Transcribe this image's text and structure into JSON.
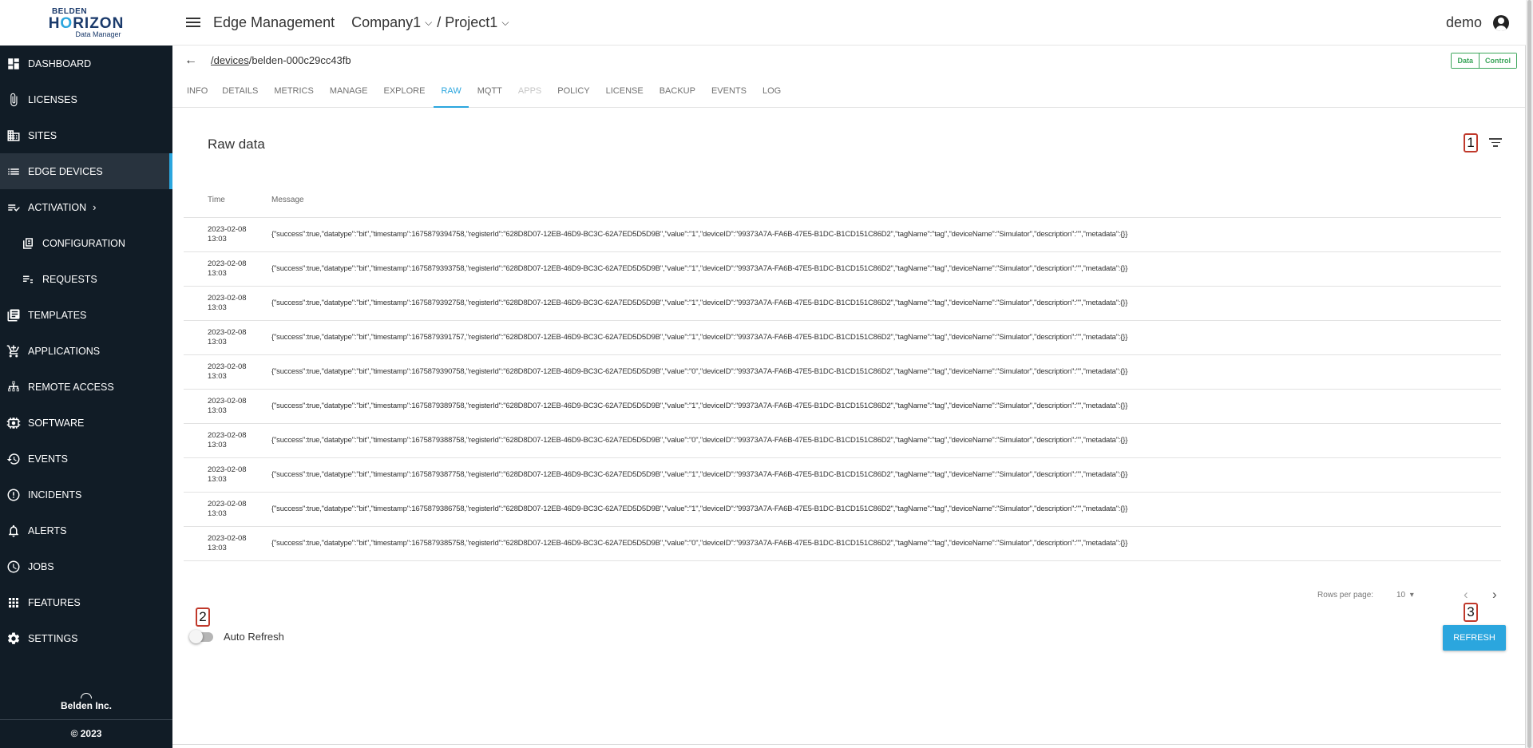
{
  "logo": {
    "brand": "BELDEN",
    "product_pre": "H",
    "product_o": "O",
    "product_post": "RIZON",
    "subtitle": "Data Manager"
  },
  "sidebar": {
    "items": [
      {
        "label": "DASHBOARD",
        "icon": "dashboard-icon"
      },
      {
        "label": "LICENSES",
        "icon": "paperclip-icon"
      },
      {
        "label": "SITES",
        "icon": "building-icon"
      },
      {
        "label": "EDGE DEVICES",
        "icon": "list-icon",
        "active": true
      },
      {
        "label": "ACTIVATION",
        "icon": "checklist-icon",
        "chevron": "›"
      },
      {
        "label": "CONFIGURATION",
        "icon": "config-icon"
      },
      {
        "label": "REQUESTS",
        "icon": "requests-icon"
      },
      {
        "label": "TEMPLATES",
        "icon": "templates-icon"
      },
      {
        "label": "APPLICATIONS",
        "icon": "cart-icon"
      },
      {
        "label": "REMOTE ACCESS",
        "icon": "network-icon"
      },
      {
        "label": "SOFTWARE",
        "icon": "software-icon"
      },
      {
        "label": "EVENTS",
        "icon": "history-icon"
      },
      {
        "label": "INCIDENTS",
        "icon": "alert-circle-icon"
      },
      {
        "label": "ALERTS",
        "icon": "bell-icon"
      },
      {
        "label": "JOBS",
        "icon": "clock-icon"
      },
      {
        "label": "FEATURES",
        "icon": "grid-icon"
      },
      {
        "label": "SETTINGS",
        "icon": "gear-icon"
      }
    ],
    "footer": {
      "company": "Belden Inc.",
      "copyright": "© 2023"
    }
  },
  "header": {
    "title": "Edge Management",
    "company": "Company1",
    "separator": "/",
    "project": "Project1",
    "user": "demo"
  },
  "device": {
    "path_link": "/devices",
    "path_rest": "/belden-000c29cc43fb",
    "toggle": [
      "Data",
      "Control"
    ]
  },
  "tabs": [
    {
      "label": "INFO"
    },
    {
      "label": "DETAILS"
    },
    {
      "label": "METRICS"
    },
    {
      "label": "MANAGE"
    },
    {
      "label": "EXPLORE"
    },
    {
      "label": "RAW",
      "active": true
    },
    {
      "label": "MQTT"
    },
    {
      "label": "APPS",
      "disabled": true
    },
    {
      "label": "POLICY"
    },
    {
      "label": "LICENSE"
    },
    {
      "label": "BACKUP"
    },
    {
      "label": "EVENTS"
    },
    {
      "label": "LOG"
    }
  ],
  "panel": {
    "title": "Raw data"
  },
  "markers": {
    "m1": "1",
    "m2": "2",
    "m3": "3"
  },
  "table": {
    "columns": [
      "Time",
      "Message"
    ],
    "rows": [
      {
        "date": "2023-02-08",
        "time": "13:03",
        "message": "{\"success\":true,\"datatype\":\"bit\",\"timestamp\":1675879394758,\"registerId\":\"628D8D07-12EB-46D9-BC3C-62A7ED5D5D9B\",\"value\":\"1\",\"deviceID\":\"99373A7A-FA6B-47E5-B1DC-B1CD151C86D2\",\"tagName\":\"tag\",\"deviceName\":\"Simulator\",\"description\":\"\",\"metadata\":{}}"
      },
      {
        "date": "2023-02-08",
        "time": "13:03",
        "message": "{\"success\":true,\"datatype\":\"bit\",\"timestamp\":1675879393758,\"registerId\":\"628D8D07-12EB-46D9-BC3C-62A7ED5D5D9B\",\"value\":\"1\",\"deviceID\":\"99373A7A-FA6B-47E5-B1DC-B1CD151C86D2\",\"tagName\":\"tag\",\"deviceName\":\"Simulator\",\"description\":\"\",\"metadata\":{}}"
      },
      {
        "date": "2023-02-08",
        "time": "13:03",
        "message": "{\"success\":true,\"datatype\":\"bit\",\"timestamp\":1675879392758,\"registerId\":\"628D8D07-12EB-46D9-BC3C-62A7ED5D5D9B\",\"value\":\"1\",\"deviceID\":\"99373A7A-FA6B-47E5-B1DC-B1CD151C86D2\",\"tagName\":\"tag\",\"deviceName\":\"Simulator\",\"description\":\"\",\"metadata\":{}}"
      },
      {
        "date": "2023-02-08",
        "time": "13:03",
        "message": "{\"success\":true,\"datatype\":\"bit\",\"timestamp\":1675879391757,\"registerId\":\"628D8D07-12EB-46D9-BC3C-62A7ED5D5D9B\",\"value\":\"1\",\"deviceID\":\"99373A7A-FA6B-47E5-B1DC-B1CD151C86D2\",\"tagName\":\"tag\",\"deviceName\":\"Simulator\",\"description\":\"\",\"metadata\":{}}"
      },
      {
        "date": "2023-02-08",
        "time": "13:03",
        "message": "{\"success\":true,\"datatype\":\"bit\",\"timestamp\":1675879390758,\"registerId\":\"628D8D07-12EB-46D9-BC3C-62A7ED5D5D9B\",\"value\":\"0\",\"deviceID\":\"99373A7A-FA6B-47E5-B1DC-B1CD151C86D2\",\"tagName\":\"tag\",\"deviceName\":\"Simulator\",\"description\":\"\",\"metadata\":{}}"
      },
      {
        "date": "2023-02-08",
        "time": "13:03",
        "message": "{\"success\":true,\"datatype\":\"bit\",\"timestamp\":1675879389758,\"registerId\":\"628D8D07-12EB-46D9-BC3C-62A7ED5D5D9B\",\"value\":\"1\",\"deviceID\":\"99373A7A-FA6B-47E5-B1DC-B1CD151C86D2\",\"tagName\":\"tag\",\"deviceName\":\"Simulator\",\"description\":\"\",\"metadata\":{}}"
      },
      {
        "date": "2023-02-08",
        "time": "13:03",
        "message": "{\"success\":true,\"datatype\":\"bit\",\"timestamp\":1675879388758,\"registerId\":\"628D8D07-12EB-46D9-BC3C-62A7ED5D5D9B\",\"value\":\"0\",\"deviceID\":\"99373A7A-FA6B-47E5-B1DC-B1CD151C86D2\",\"tagName\":\"tag\",\"deviceName\":\"Simulator\",\"description\":\"\",\"metadata\":{}}"
      },
      {
        "date": "2023-02-08",
        "time": "13:03",
        "message": "{\"success\":true,\"datatype\":\"bit\",\"timestamp\":1675879387758,\"registerId\":\"628D8D07-12EB-46D9-BC3C-62A7ED5D5D9B\",\"value\":\"1\",\"deviceID\":\"99373A7A-FA6B-47E5-B1DC-B1CD151C86D2\",\"tagName\":\"tag\",\"deviceName\":\"Simulator\",\"description\":\"\",\"metadata\":{}}"
      },
      {
        "date": "2023-02-08",
        "time": "13:03",
        "message": "{\"success\":true,\"datatype\":\"bit\",\"timestamp\":1675879386758,\"registerId\":\"628D8D07-12EB-46D9-BC3C-62A7ED5D5D9B\",\"value\":\"1\",\"deviceID\":\"99373A7A-FA6B-47E5-B1DC-B1CD151C86D2\",\"tagName\":\"tag\",\"deviceName\":\"Simulator\",\"description\":\"\",\"metadata\":{}}"
      },
      {
        "date": "2023-02-08",
        "time": "13:03",
        "message": "{\"success\":true,\"datatype\":\"bit\",\"timestamp\":1675879385758,\"registerId\":\"628D8D07-12EB-46D9-BC3C-62A7ED5D5D9B\",\"value\":\"0\",\"deviceID\":\"99373A7A-FA6B-47E5-B1DC-B1CD151C86D2\",\"tagName\":\"tag\",\"deviceName\":\"Simulator\",\"description\":\"\",\"metadata\":{}}"
      }
    ]
  },
  "pagination": {
    "rows_per_page_label": "Rows per page:",
    "rows_per_page_value": "10",
    "dropdown_arrow": "▾",
    "prev": "‹",
    "next": "›"
  },
  "auto_refresh": {
    "label": "Auto Refresh",
    "enabled": false
  },
  "refresh_button": {
    "label": "REFRESH"
  },
  "colors": {
    "sidebar_bg": "#111c26",
    "accent": "#2ba6de",
    "toggle_green": "#3aa55a",
    "marker_red": "#c0392b"
  }
}
